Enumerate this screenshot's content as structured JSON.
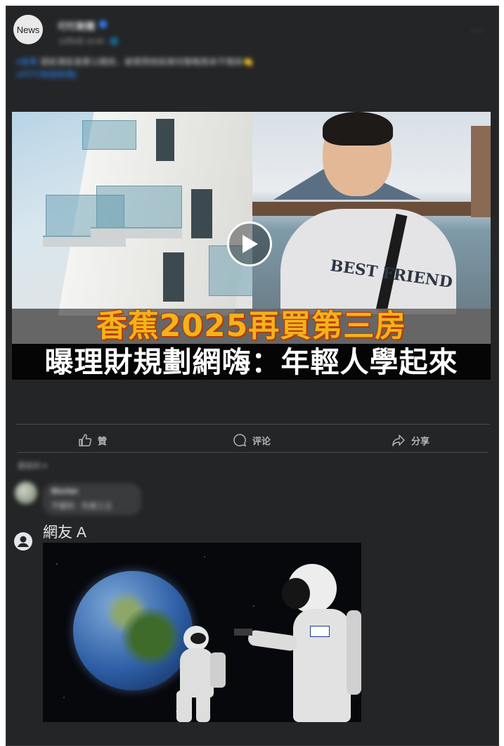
{
  "post": {
    "avatar_label": "News",
    "page_name": "叮叮新聞",
    "timestamp": "12月4日 14:40 · 🌐",
    "more": "···",
    "caption_tag": "#香蕉",
    "caption_text": "週前港區香蕉公開房，被質問他投資何策略再來不隨來🍋",
    "caption_link": "(#叮叮財經新聞)"
  },
  "video": {
    "title_line1": "香蕉2025再買第三房",
    "title_line2": "曝理財規劃網嗨：年輕人學起來",
    "shirt_text": "BEST FRIEND"
  },
  "actions": {
    "like": "贊",
    "comment": "评论",
    "share": "分享"
  },
  "comments": {
    "filter_label": "最相关 ▾",
    "blurred": {
      "name": "Blurlan",
      "text": "不服你 · 先後工立"
    },
    "visible": {
      "author": "網友 A"
    }
  },
  "colors": {
    "card_bg": "#242526",
    "title_yellow": "#f2b21c",
    "verified_blue": "#2d88ff"
  }
}
